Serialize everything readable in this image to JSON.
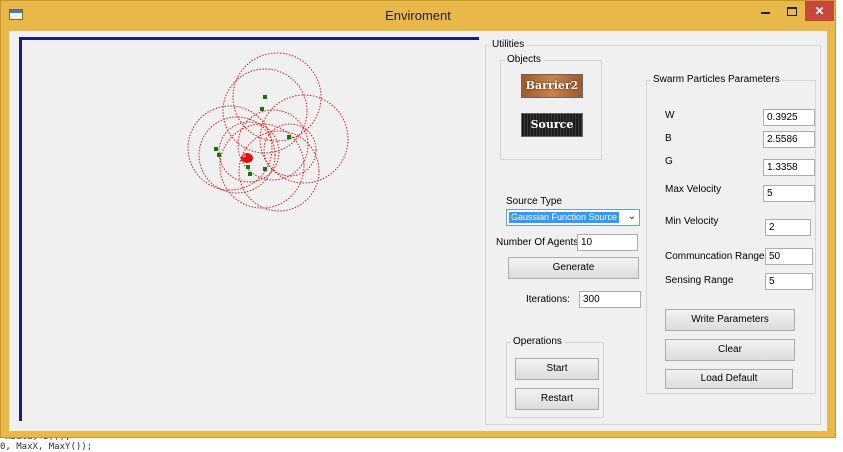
{
  "window": {
    "title": "Enviroment"
  },
  "background_code": [
    "ʻnData; 3)));",
    "0, MaxX, MaxY());"
  ],
  "colors": {
    "frame": "#e8b84a",
    "panel_border": "#1a1a8c",
    "agent": "#0a7a0a",
    "source": "#e01010",
    "selection": "#3399ff"
  },
  "utilities": {
    "title": "Utilities",
    "objects": {
      "title": "Objects",
      "barrier_label": "Barrier2",
      "source_label": "Source"
    },
    "source_type": {
      "label": "Source Type",
      "selected": "Gaussian Function Source"
    },
    "number_of_agents": {
      "label": "Number Of Agents",
      "value": "10"
    },
    "generate_label": "Generate",
    "iterations": {
      "label": "Iterations:",
      "value": "300"
    },
    "operations": {
      "title": "Operations",
      "start_label": "Start",
      "restart_label": "Restart"
    }
  },
  "params": {
    "title": "Swarm Particles Parameters",
    "w": {
      "label": "W",
      "value": "0.3925"
    },
    "b": {
      "label": "B",
      "value": "2.5586"
    },
    "g": {
      "label": "G",
      "value": "1.3358"
    },
    "max_velocity": {
      "label": "Max Velocity",
      "value": "5"
    },
    "min_velocity": {
      "label": "Min Velocity",
      "value": "2"
    },
    "communication_range": {
      "label": "Communcation Range",
      "value": "50"
    },
    "sensing_range": {
      "label": "Sensing Range",
      "value": "5"
    },
    "write_label": "Write Parameters",
    "clear_label": "Clear",
    "load_default_label": "Load Default"
  }
}
